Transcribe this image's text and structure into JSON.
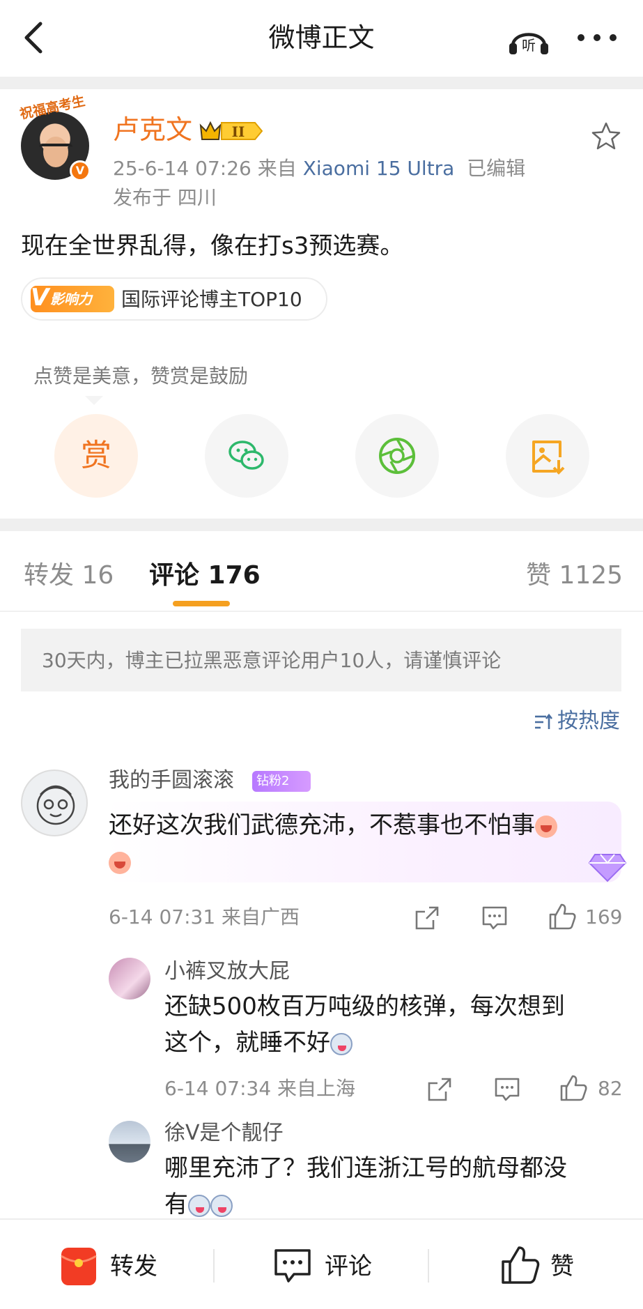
{
  "header": {
    "title": "微博正文"
  },
  "post": {
    "author": "卢克文",
    "avatar_caption": "祝福高考生",
    "meta_line": "25-6-14 07:26  来自",
    "device": "Xiaomi 15 Ultra",
    "edited": "已编辑",
    "location": "发布于 四川",
    "text": "现在全世界乱得，像在打s3预选赛。",
    "tag_label": "影响力",
    "tag_text": "国际评论博主TOP10"
  },
  "reward": {
    "tip": "点赞是美意，赞赏是鼓励",
    "reward_label": "赏"
  },
  "tabs": {
    "repost": "转发 16",
    "comments": "评论 176",
    "likes": "赞 1125"
  },
  "notice": "30天内，博主已拉黑恶意评论用户10人，请谨慎评论",
  "sort_label": "按热度",
  "comments": [
    {
      "user": "我的手圆滚滚",
      "badge": "钻粉2",
      "text": "还好这次我们武德充沛，不惹事也不怕事",
      "time": "6-14 07:31  来自广西",
      "likes": "169"
    }
  ],
  "replies": [
    {
      "user": "小裤叉放大屁",
      "text_line1": "还缺500枚百万吨级的核弹，每次想到",
      "text_line2": "这个，就睡不好",
      "time": "6-14 07:34  来自上海",
      "likes": "82"
    },
    {
      "user": "徐V是个靓仔",
      "text_line1": "哪里充沛了？我们连浙江号的航母都没",
      "text_line2": "有"
    }
  ],
  "bottom": {
    "repost": "转发",
    "comment": "评论",
    "like": "赞"
  },
  "colors": {
    "author": "#f07420",
    "link": "#4a6ea0",
    "tab_underline": "#f5a020",
    "muted": "#8c8c8c"
  }
}
